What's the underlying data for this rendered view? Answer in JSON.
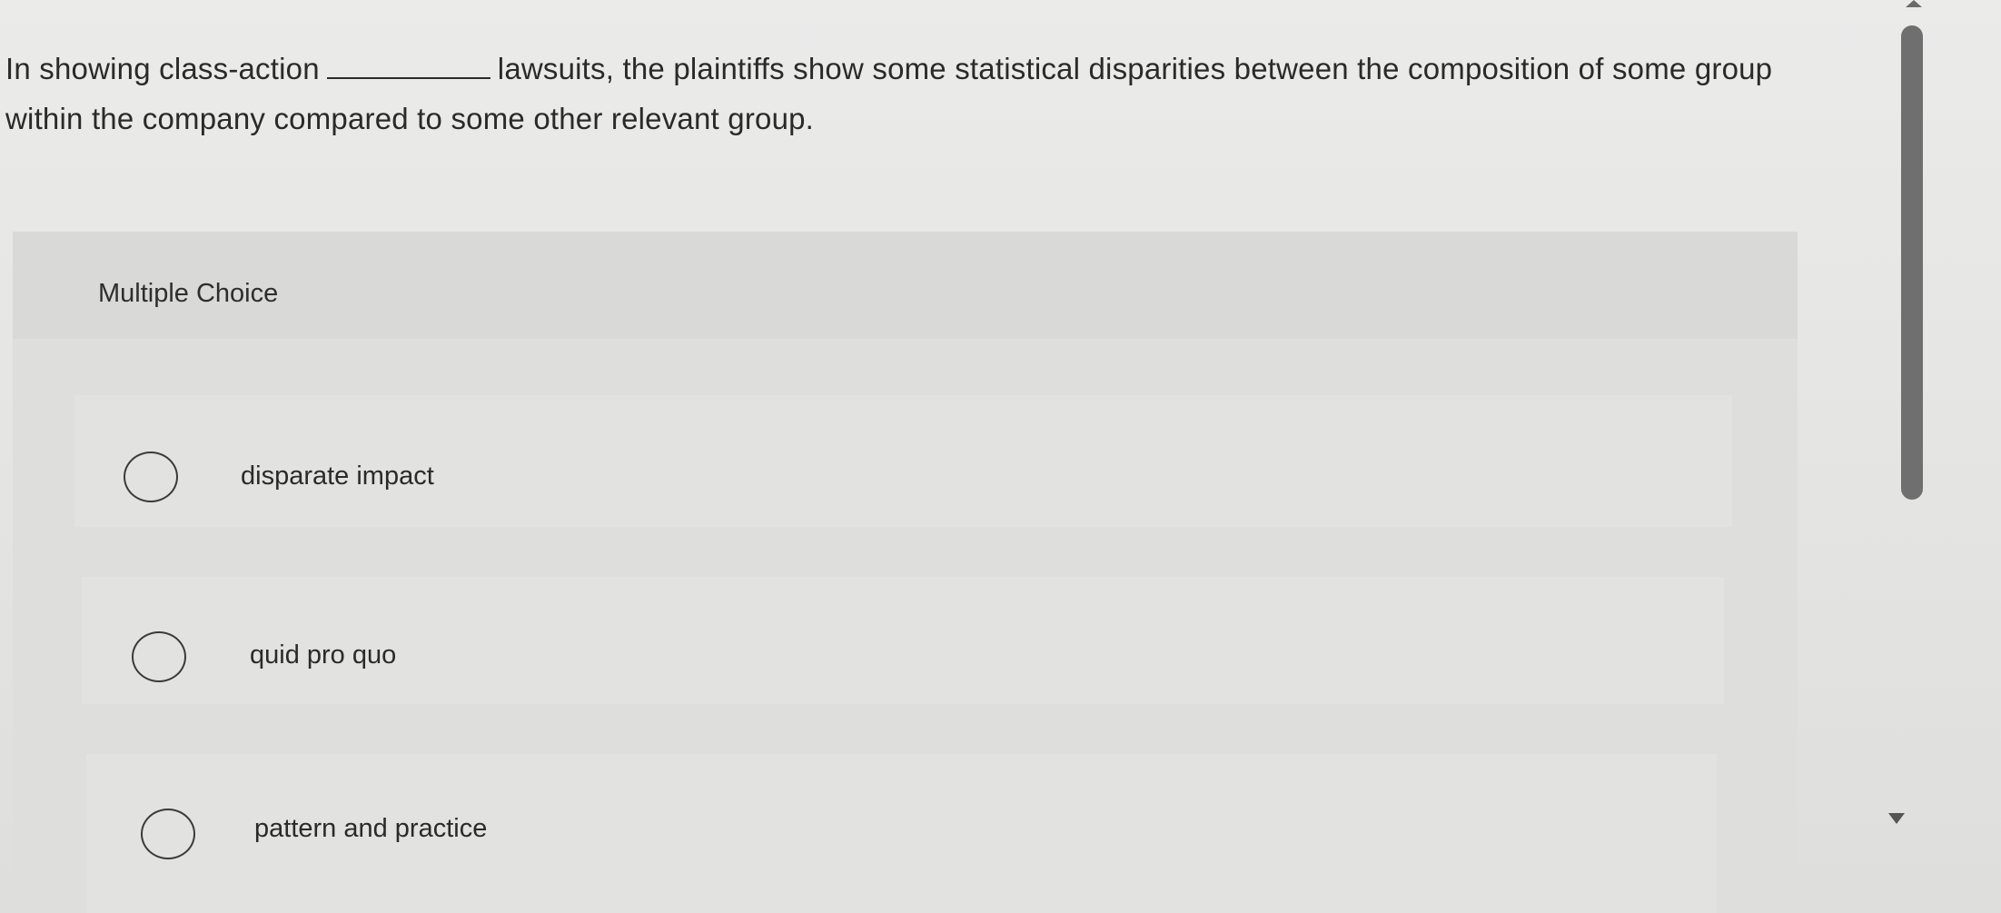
{
  "question": {
    "text_before_blank": "In showing class-action",
    "text_after_blank": "lawsuits, the plaintiffs show some statistical disparities between the composition of some group within the company compared to some other relevant group."
  },
  "panel": {
    "title": "Multiple Choice"
  },
  "options": [
    {
      "label": "disparate impact",
      "selected": false
    },
    {
      "label": "quid pro quo",
      "selected": false
    },
    {
      "label": "pattern and practice",
      "selected": false
    }
  ],
  "scrollbar": {
    "up_icon": "scroll-up-arrow-icon",
    "down_icon": "scroll-down-arrow-icon"
  },
  "colors": {
    "background": "#e6e6e4",
    "panel": "#dededc",
    "text": "#2a2a2a",
    "scroll_thumb": "#6f6f6f"
  }
}
